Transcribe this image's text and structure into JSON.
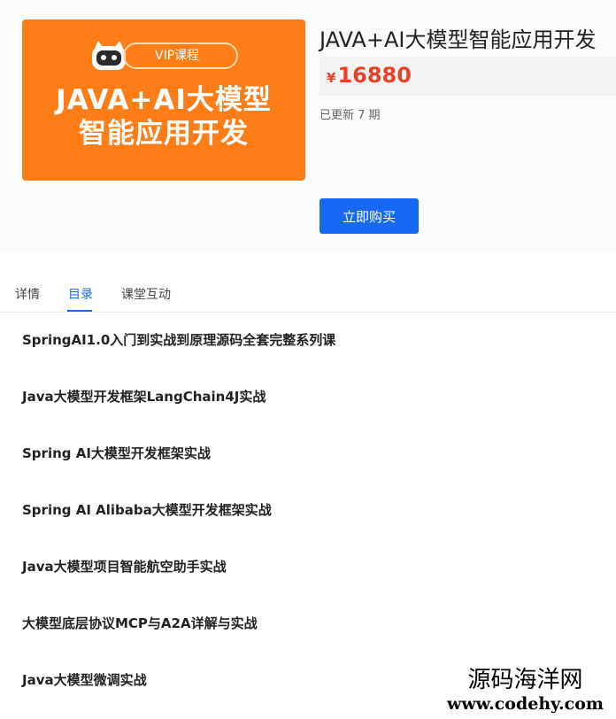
{
  "product": {
    "cover": {
      "badge_label": "VIP课程",
      "title_line1": "JAVA+AI大模型",
      "title_line2": "智能应用开发",
      "color": "#ff7d17"
    },
    "title": "JAVA+AI大模型智能应用开发",
    "price_currency": "¥",
    "price_value": "16880",
    "update_status": "已更新 7 期",
    "buy_label": "立即购买",
    "price_color": "#e8412a",
    "accent": "#1769f1"
  },
  "tabs": [
    {
      "label": "详情",
      "active": false
    },
    {
      "label": "目录",
      "active": true
    },
    {
      "label": "课堂互动",
      "active": false
    }
  ],
  "lessons": [
    "SpringAI1.0入门到实战到原理源码全套完整系列课",
    "Java大模型开发框架LangChain4J实战",
    "Spring AI大模型开发框架实战",
    "Spring AI Alibaba大模型开发框架实战",
    "Java大模型项目智能航空助手实战",
    "大模型底层协议MCP与A2A详解与实战",
    "Java大模型微调实战"
  ],
  "watermark": {
    "name": "源码海洋网",
    "url": "www.codehy.com"
  }
}
